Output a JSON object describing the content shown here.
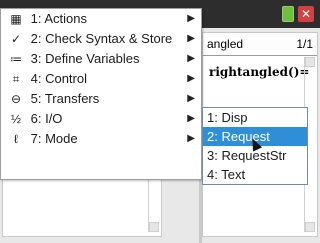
{
  "window": {
    "close_glyph": "✕"
  },
  "editor": {
    "file_label": "angled",
    "page_label": "1/1",
    "code_line": "rightangled()="
  },
  "menu": {
    "items": [
      {
        "icon": "actions-icon",
        "icon_glyph": "▦",
        "label": "1: Actions",
        "has_submenu": true
      },
      {
        "icon": "check-syntax-icon",
        "icon_glyph": "✓",
        "label": "2: Check Syntax & Store",
        "has_submenu": true
      },
      {
        "icon": "define-variables-icon",
        "icon_glyph": "≔",
        "label": "3: Define Variables",
        "has_submenu": true
      },
      {
        "icon": "control-icon",
        "icon_glyph": "⌗",
        "label": "4: Control",
        "has_submenu": true
      },
      {
        "icon": "transfers-icon",
        "icon_glyph": "⊖",
        "label": "5: Transfers",
        "has_submenu": true
      },
      {
        "icon": "io-icon",
        "icon_glyph": "½",
        "label": "6: I/O",
        "has_submenu": true,
        "selected": true
      },
      {
        "icon": "mode-icon",
        "icon_glyph": "ℓ",
        "label": "7: Mode",
        "has_submenu": true
      }
    ]
  },
  "submenu": {
    "items": [
      {
        "label": "1: Disp"
      },
      {
        "label": "2: Request",
        "highlight": true
      },
      {
        "label": "3: RequestStr"
      },
      {
        "label": "4: Text"
      }
    ]
  }
}
